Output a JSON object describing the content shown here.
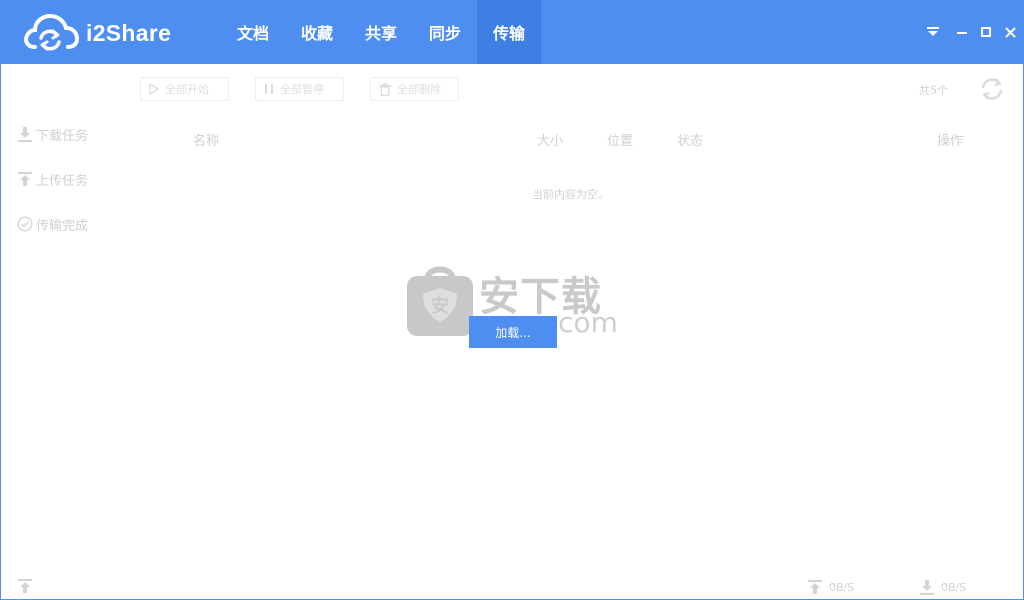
{
  "app": {
    "name": "i2Share"
  },
  "nav": {
    "tabs": [
      {
        "label": "文档",
        "active": false
      },
      {
        "label": "收藏",
        "active": false
      },
      {
        "label": "共享",
        "active": false
      },
      {
        "label": "同步",
        "active": false
      },
      {
        "label": "传输",
        "active": true
      }
    ]
  },
  "window_controls": [
    "dropdown-icon",
    "minimize-icon",
    "maximize-icon",
    "close-icon"
  ],
  "sidebar": {
    "items": [
      {
        "label": "下载任务",
        "icon": "download-icon"
      },
      {
        "label": "上传任务",
        "icon": "upload-icon"
      },
      {
        "label": "传输完成",
        "icon": "check-circle-icon"
      }
    ]
  },
  "toolbar": {
    "start_all": "全部开始",
    "pause_all": "全部暂停",
    "delete_all": "全部删除",
    "count": "共5个"
  },
  "table": {
    "columns": {
      "name": "名称",
      "size": "大小",
      "location": "位置",
      "status": "状态",
      "action": "操作"
    },
    "empty_text": "当前内容为空。"
  },
  "overlay": {
    "loading_text": "加载...",
    "watermark_text": "安下载",
    "watermark_url": "anxz.com",
    "watermark_badge": "安"
  },
  "footer": {
    "upload_speed": "0B/S",
    "download_speed": "0B/S"
  },
  "colors": {
    "accent": "#4e8ef0",
    "active_tab": "#3f7fe3",
    "muted_text": "#d0d0d0"
  }
}
